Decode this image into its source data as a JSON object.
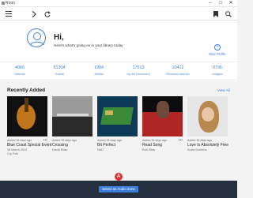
{
  "window": {
    "title": "Roon",
    "minimize_glyph": "–",
    "maximize_glyph": "□",
    "close_glyph": "✕"
  },
  "toolbar": {
    "menu_icon": "hamburger-menu-icon",
    "forward_icon": "chevron-right-icon",
    "refresh_icon": "refresh-icon",
    "bookmark_icon": "bookmark-icon",
    "search_icon": "search-icon"
  },
  "profile": {
    "greeting": "Hi,",
    "subtitle": "Here's what's going on in your library today",
    "new_profile_label": "New Profile",
    "accent": "#3d7edb"
  },
  "stats": [
    {
      "value": "4066",
      "label": "Albums"
    },
    {
      "value": "51304",
      "label": "Tracks"
    },
    {
      "value": "1984",
      "label": "Artists"
    },
    {
      "value": "17513",
      "label": "Up for Discovery"
    },
    {
      "value": "10412",
      "label": "Reviews and bio"
    },
    {
      "value": "0736",
      "label": "Images"
    }
  ],
  "recently_added": {
    "title": "Recently Added",
    "view_all": "View All",
    "albums": [
      {
        "added": "Added 35 days ago",
        "title": "Blue Coast Special Event",
        "subtitle": "18 March 2012",
        "artist": "Cry Folk",
        "colors": [
          "#111111",
          "#c0761a"
        ]
      },
      {
        "added": "Added 35 days ago",
        "title": "Crossing",
        "subtitle": "",
        "artist": "David Elias",
        "colors": [
          "#3a3a3a",
          "#d9d9d9"
        ]
      },
      {
        "added": "Added 35 days ago",
        "title": "Bit Perfect",
        "subtitle": "",
        "artist": "NAD",
        "colors": [
          "#0d3a57",
          "#3a8a3a"
        ]
      },
      {
        "added": "Added 35 days ago",
        "title": "Read Song",
        "subtitle": "",
        "artist": "Rob Elias",
        "colors": [
          "#0d0d0d",
          "#b02525"
        ]
      },
      {
        "added": "Added 35 days ago",
        "title": "Love Is Absolutely Free",
        "subtitle": "",
        "artist": "Suzie Dobbins",
        "colors": [
          "#e6e6e6",
          "#b8894f"
        ]
      }
    ]
  },
  "bottom_bar": {
    "zone_button_label": "Select an Audio Zone",
    "badge_label": "A",
    "badge_color": "#e03333"
  }
}
